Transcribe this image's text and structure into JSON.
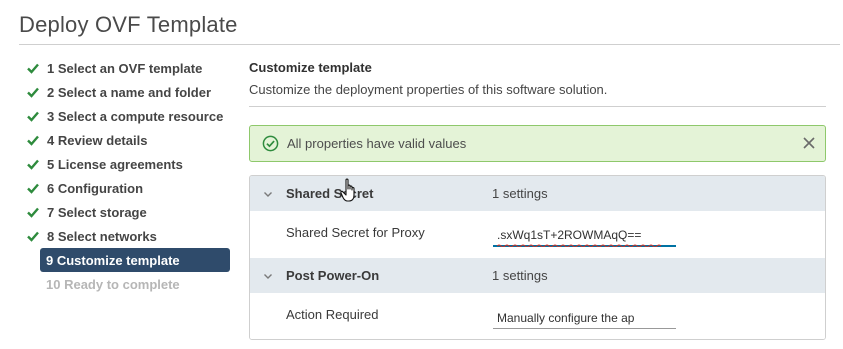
{
  "dialog": {
    "title": "Deploy OVF Template"
  },
  "steps": [
    {
      "label": "1 Select an OVF template",
      "state": "done"
    },
    {
      "label": "2 Select a name and folder",
      "state": "done"
    },
    {
      "label": "3 Select a compute resource",
      "state": "done"
    },
    {
      "label": "4 Review details",
      "state": "done"
    },
    {
      "label": "5 License agreements",
      "state": "done"
    },
    {
      "label": "6 Configuration",
      "state": "done"
    },
    {
      "label": "7 Select storage",
      "state": "done"
    },
    {
      "label": "8 Select networks",
      "state": "done"
    },
    {
      "label": "9 Customize template",
      "state": "active"
    },
    {
      "label": "10 Ready to complete",
      "state": "disabled"
    }
  ],
  "main": {
    "heading": "Customize template",
    "description": "Customize the deployment properties of this software solution."
  },
  "alert": {
    "message": "All properties have valid values",
    "icon": "check-circle-icon",
    "color": "#8ec86b"
  },
  "groups": [
    {
      "name": "Shared Secret",
      "count": "1 settings",
      "property": {
        "label": "Shared Secret for Proxy",
        "value": ".sxWq1sT+2ROWMAqQ=="
      }
    },
    {
      "name": "Post Power-On",
      "count": "1 settings",
      "property": {
        "label": "Action Required",
        "value": "Manually configure the ap"
      }
    }
  ],
  "colors": {
    "accent": "#2f4b6b",
    "success": "#2e8b3d",
    "focus": "#0072a3"
  }
}
